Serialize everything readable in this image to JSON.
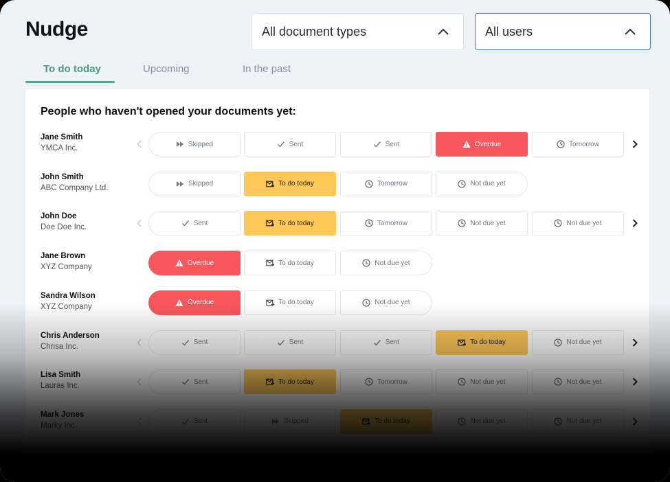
{
  "brand": "Nudge",
  "filters": {
    "document_types": "All document types",
    "users": "All users"
  },
  "tabs": [
    {
      "label": "To do today",
      "active": true
    },
    {
      "label": "Upcoming",
      "active": false
    },
    {
      "label": "In the past",
      "active": false
    }
  ],
  "heading": "People who haven't opened your documents yet:",
  "colors": {
    "accent": "#5aa58e",
    "overdue": "#f8575c",
    "todo": "#ffc858",
    "user_filter_border": "#4a78c4"
  },
  "rows": [
    {
      "name": "Jane Smith",
      "company": "YMCA Inc.",
      "left_arrow": true,
      "right_arrow": true,
      "steps": [
        {
          "status": "skipped",
          "label": "Skipped"
        },
        {
          "status": "sent",
          "label": "Sent"
        },
        {
          "status": "sent",
          "label": "Sent"
        },
        {
          "status": "overdue",
          "label": "Overdue"
        },
        {
          "status": "tomorrow",
          "label": "Tomorrow"
        }
      ]
    },
    {
      "name": "John Smith",
      "company": "ABC Company Ltd.",
      "left_arrow": false,
      "right_arrow": false,
      "steps": [
        {
          "status": "skipped",
          "label": "Skipped"
        },
        {
          "status": "todo-active",
          "label": "To do today"
        },
        {
          "status": "tomorrow",
          "label": "Tomorrow"
        },
        {
          "status": "notdue",
          "label": "Not due yet"
        }
      ]
    },
    {
      "name": "John Doe",
      "company": "Doe Doe Inc.",
      "left_arrow": true,
      "right_arrow": true,
      "steps": [
        {
          "status": "sent",
          "label": "Sent"
        },
        {
          "status": "todo-active",
          "label": "To do today"
        },
        {
          "status": "tomorrow",
          "label": "Tomorrow"
        },
        {
          "status": "notdue",
          "label": "Not due yet"
        },
        {
          "status": "notdue",
          "label": "Not due yet"
        }
      ]
    },
    {
      "name": "Jane Brown",
      "company": "XYZ Company",
      "left_arrow": false,
      "right_arrow": false,
      "steps": [
        {
          "status": "overdue",
          "label": "Overdue"
        },
        {
          "status": "todo",
          "label": "To do today"
        },
        {
          "status": "notdue",
          "label": "Not due yet"
        }
      ]
    },
    {
      "name": "Sandra Wilson",
      "company": "XYZ Company",
      "left_arrow": false,
      "right_arrow": false,
      "steps": [
        {
          "status": "overdue",
          "label": "Overdue"
        },
        {
          "status": "todo",
          "label": "To do today"
        },
        {
          "status": "notdue",
          "label": "Not due yet"
        }
      ]
    },
    {
      "name": "Chris Anderson",
      "company": "Chrisa Inc.",
      "left_arrow": true,
      "right_arrow": true,
      "steps": [
        {
          "status": "sent",
          "label": "Sent"
        },
        {
          "status": "sent",
          "label": "Sent"
        },
        {
          "status": "sent",
          "label": "Sent"
        },
        {
          "status": "todo-active",
          "label": "To do today"
        },
        {
          "status": "notdue",
          "label": "Not due yet"
        }
      ]
    },
    {
      "name": "Lisa Smith",
      "company": "Lauras Inc.",
      "left_arrow": true,
      "right_arrow": true,
      "steps": [
        {
          "status": "sent",
          "label": "Sent"
        },
        {
          "status": "todo-active",
          "label": "To do today"
        },
        {
          "status": "tomorrow",
          "label": "Tomorrow"
        },
        {
          "status": "notdue",
          "label": "Not due yet"
        },
        {
          "status": "notdue",
          "label": "Not due yet"
        }
      ]
    },
    {
      "name": "Mark Jones",
      "company": "Marky Inc.",
      "left_arrow": true,
      "right_arrow": true,
      "steps": [
        {
          "status": "sent",
          "label": "Sent"
        },
        {
          "status": "skipped",
          "label": "Skipped"
        },
        {
          "status": "todo-active",
          "label": "To do today"
        },
        {
          "status": "notdue",
          "label": "Not due yet"
        },
        {
          "status": "notdue",
          "label": "Not due yet"
        }
      ]
    }
  ]
}
